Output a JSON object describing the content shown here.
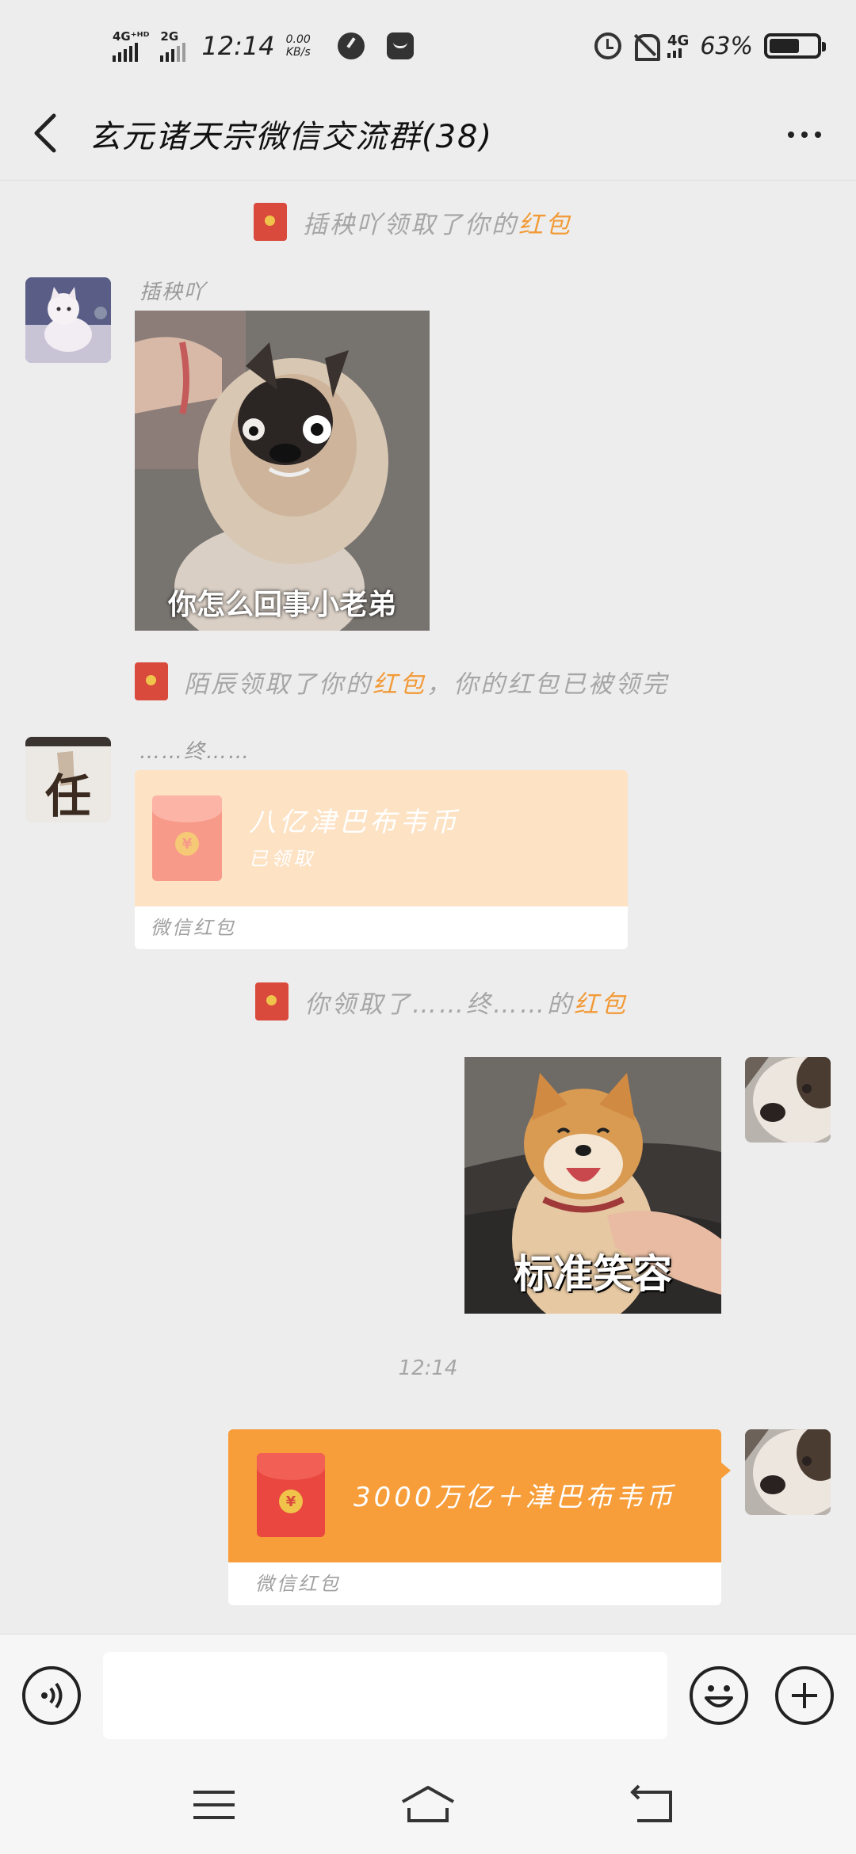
{
  "status_bar": {
    "sim1": "4G⁺ᴴᴰ",
    "sim2": "2G",
    "time": "12:14",
    "speed_value": "0.00",
    "speed_unit": "KB/s",
    "network_right": "4G",
    "battery": "63%",
    "icons": [
      "timer-icon",
      "notification-icon",
      "alarm-icon",
      "bell-off-icon",
      "battery-icon"
    ]
  },
  "header": {
    "back_icon": "chevron-left-icon",
    "title": "玄元诸天宗微信交流群(38)",
    "more_icon": "more-dots-icon"
  },
  "messages": [
    {
      "type": "notice",
      "prefix": "插秧吖领取了你的",
      "highlight": "红包",
      "suffix": ""
    },
    {
      "type": "sticker",
      "sender": "插秧吖",
      "caption": "你怎么回事小老弟"
    },
    {
      "type": "notice",
      "prefix": "陌辰领取了你的",
      "highlight": "红包",
      "suffix": "，你的红包已被领完"
    },
    {
      "type": "red_packet",
      "sender": "……终……",
      "title": "八亿津巴布韦币",
      "status": "已领取",
      "footer": "微信红包",
      "avatar_text": "任"
    },
    {
      "type": "notice",
      "prefix": "你领取了……终……的",
      "highlight": "红包",
      "suffix": ""
    },
    {
      "type": "sticker_self",
      "caption": "标准笑容"
    },
    {
      "type": "time",
      "text": "12:14"
    },
    {
      "type": "red_packet_self",
      "title": "3000万亿＋津巴布韦币",
      "footer": "微信红包"
    }
  ],
  "coin_symbol": "¥",
  "input_bar": {
    "voice_icon": "voice-icon",
    "placeholder": "",
    "emoji_icon": "emoji-icon",
    "plus_icon": "plus-icon"
  },
  "nav_bar": {
    "icons": [
      "menu-icon",
      "home-icon",
      "back-nav-icon"
    ]
  },
  "colors": {
    "background": "#ededed",
    "red_packet_orange": "#f79d3a",
    "red_packet_claimed": "#fde2c4",
    "highlight_orange": "#f29a37",
    "envelope_red": "#d94a3d"
  }
}
